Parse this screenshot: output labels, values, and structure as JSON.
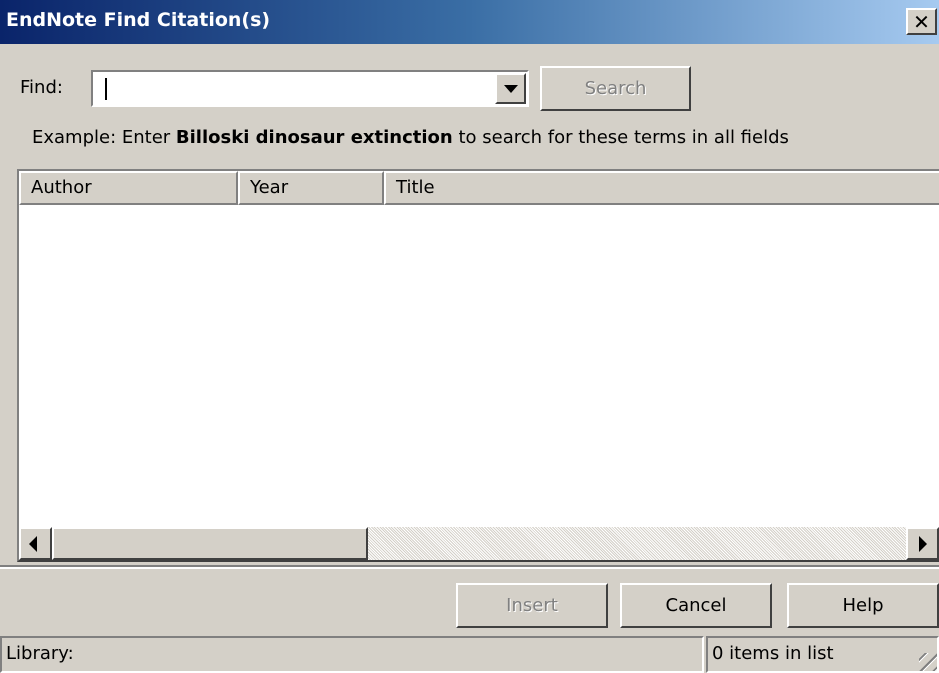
{
  "window": {
    "title": "EndNote Find Citation(s)",
    "close_glyph": "✕"
  },
  "find": {
    "label": "Find:",
    "value": "",
    "search_label": "Search"
  },
  "example": {
    "prefix": "Example: Enter ",
    "terms": "Billoski dinosaur extinction",
    "suffix": " to search for these terms in all fields"
  },
  "table": {
    "columns": [
      "Author",
      "Year",
      "Title"
    ],
    "rows": []
  },
  "buttons": {
    "insert": "Insert",
    "cancel": "Cancel",
    "help": "Help"
  },
  "status": {
    "library": "Library:",
    "count": "0 items in list"
  }
}
